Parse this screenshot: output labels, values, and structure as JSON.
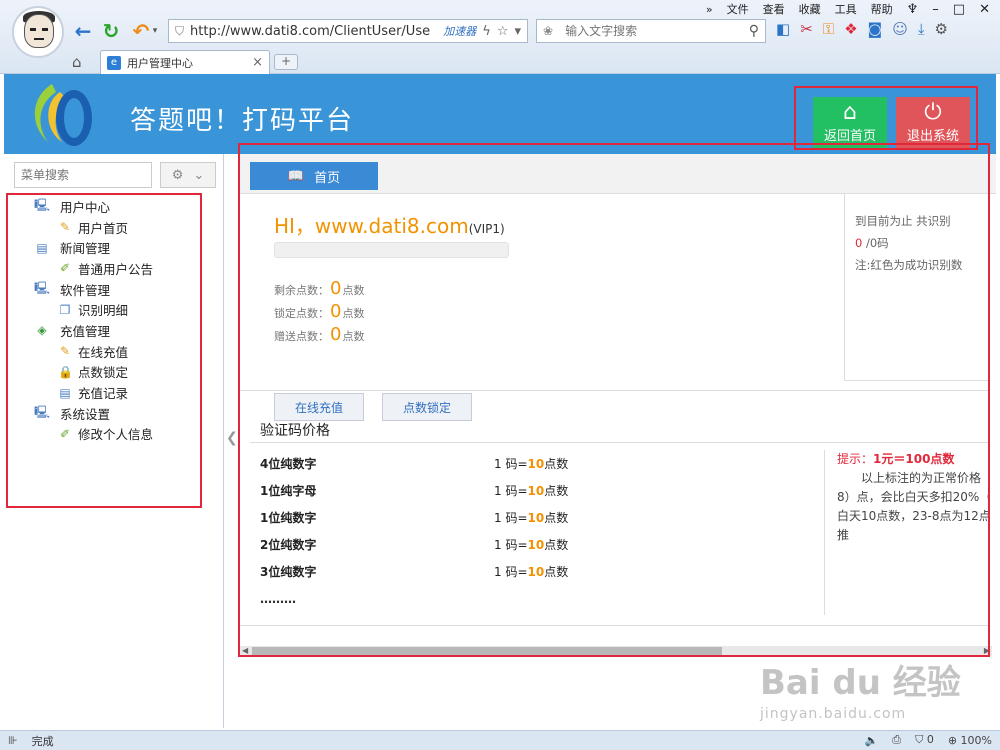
{
  "browser": {
    "menu": [
      "文件",
      "查看",
      "收藏",
      "工具",
      "帮助"
    ],
    "url": "http://www.dati8.com/ClientUser/Use",
    "accelerator": "加速器",
    "search_placeholder": "输入文字搜索",
    "tab_title": "用户管理中心",
    "tab_close": "×",
    "new_tab": "+",
    "status_text": "完成",
    "security_count": "0",
    "zoom": "100%"
  },
  "header": {
    "title": "答题吧！打码平台",
    "home_button": "返回首页",
    "exit_button": "退出系统"
  },
  "sidebar": {
    "search_placeholder": "菜单搜索",
    "groups": [
      {
        "label": "用户中心",
        "items": [
          "用户首页"
        ]
      },
      {
        "label": "新闻管理",
        "items": [
          "普通用户公告"
        ]
      },
      {
        "label": "软件管理",
        "items": [
          "识别明细"
        ]
      },
      {
        "label": "充值管理",
        "items": [
          "在线充值",
          "点数锁定",
          "充值记录"
        ]
      },
      {
        "label": "系统设置",
        "items": [
          "修改个人信息"
        ]
      }
    ]
  },
  "main": {
    "tab_label": "首页",
    "greeting": "HI，www.dati8.com",
    "vip": "(VIP1)",
    "points": [
      {
        "label": "剩余点数：",
        "value": "0",
        "unit": "点数"
      },
      {
        "label": "锁定点数：",
        "value": "0",
        "unit": "点数"
      },
      {
        "label": "赠送点数：",
        "value": "0",
        "unit": "点数"
      }
    ],
    "recharge_button": "在线充值",
    "lock_button": "点数锁定",
    "stats": {
      "line1": "到目前为止 共识别",
      "count_red": "0",
      "count_rest": "/0码",
      "note": "注:红色为成功识别数"
    },
    "price_title": "验证码价格",
    "prices": [
      {
        "name": "4位纯数字",
        "prefix": "1 码=",
        "value": "10",
        "unit": "点数"
      },
      {
        "name": "1位纯字母",
        "prefix": "1 码=",
        "value": "10",
        "unit": "点数"
      },
      {
        "name": "1位纯数字",
        "prefix": "1 码=",
        "value": "10",
        "unit": "点数"
      },
      {
        "name": "2位纯数字",
        "prefix": "1 码=",
        "value": "10",
        "unit": "点数"
      },
      {
        "name": "3位纯数字",
        "prefix": "1 码=",
        "value": "10",
        "unit": "点数"
      }
    ],
    "dots": "………",
    "tip": {
      "head_label": "提示：",
      "head_value": "1元＝100点数",
      "body1": "以上标注的为正常价格",
      "body2": "8）点，会比白天多扣20%（",
      "body3": "白天10点数，23-8点为12点",
      "body4": "推"
    }
  },
  "watermark": {
    "line1": "Bai du 经验",
    "line2": "jingyan.baidu.com"
  },
  "colors": {
    "header_blue": "#3a94d8",
    "orange": "#f39200",
    "green_button": "#22c063",
    "red_button": "#e0555a",
    "highlight_red": "#e0283a"
  }
}
